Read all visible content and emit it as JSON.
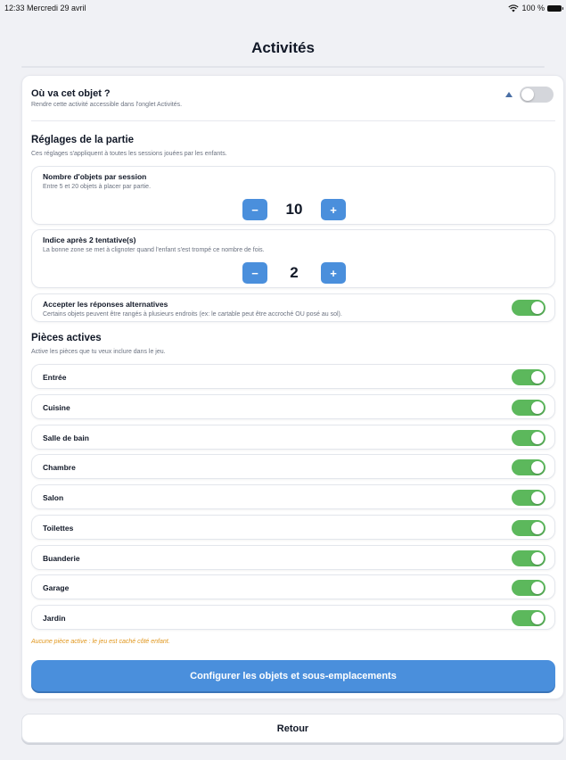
{
  "status_bar": {
    "time_date": "12:33  Mercredi 29 avril",
    "battery": "100 %"
  },
  "header": {
    "title": "Activités"
  },
  "activity": {
    "title": "Où va cet objet ?",
    "subtitle": "Rendre cette activité accessible dans l'onglet Activités.",
    "enabled": false
  },
  "settings": {
    "title": "Réglages de la partie",
    "subtitle": "Ces réglages s'appliquent à toutes les sessions jouées par les enfants.",
    "objects_per_session": {
      "title": "Nombre d'objets par session",
      "subtitle": "Entre 5 et 20 objets à placer par partie.",
      "value": "10",
      "minus": "−",
      "plus": "+"
    },
    "hint": {
      "title": "Indice après 2 tentative(s)",
      "subtitle": "La bonne zone se met à clignoter quand l'enfant s'est trompé ce nombre de fois.",
      "value": "2",
      "minus": "−",
      "plus": "+"
    },
    "alternatives": {
      "title": "Accepter les réponses alternatives",
      "subtitle": "Certains objets peuvent être rangés à plusieurs endroits (ex: le cartable peut être accroché OU posé au sol).",
      "enabled": true
    }
  },
  "rooms": {
    "title": "Pièces actives",
    "subtitle": "Active les pièces que tu veux inclure dans le jeu.",
    "items": [
      {
        "label": "Entrée",
        "enabled": true
      },
      {
        "label": "Cuisine",
        "enabled": true
      },
      {
        "label": "Salle de bain",
        "enabled": true
      },
      {
        "label": "Chambre",
        "enabled": true
      },
      {
        "label": "Salon",
        "enabled": true
      },
      {
        "label": "Toilettes",
        "enabled": true
      },
      {
        "label": "Buanderie",
        "enabled": true
      },
      {
        "label": "Garage",
        "enabled": true
      },
      {
        "label": "Jardin",
        "enabled": true
      }
    ],
    "warning": "Aucune pièce active : le jeu est caché côté enfant."
  },
  "actions": {
    "configure": "Configurer les objets et sous-emplacements",
    "back": "Retour"
  },
  "colors": {
    "accent": "#4a8fdc",
    "toggle_on": "#5cb85c",
    "toggle_off": "#d4d6db",
    "warning": "#e0961c"
  }
}
